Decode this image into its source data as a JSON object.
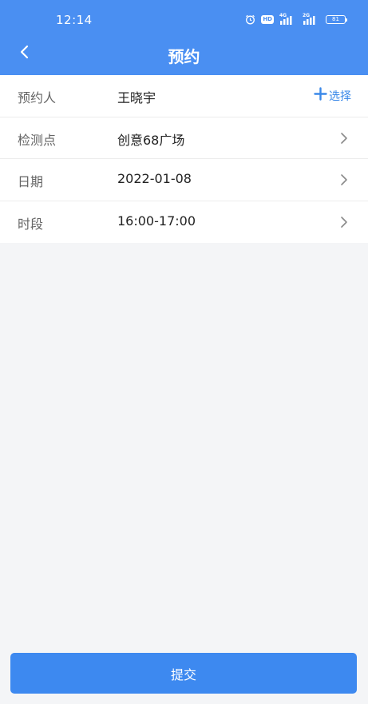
{
  "status_bar": {
    "time": "12:14",
    "hd_label": "HD",
    "network_1": "4G",
    "network_2": "2G",
    "battery": "81",
    "icons": [
      "alarm-icon",
      "hd-icon",
      "signal-4g-icon",
      "signal-2g-icon",
      "battery-icon"
    ]
  },
  "nav": {
    "title": "预约",
    "back_icon": "chevron-left-icon"
  },
  "form": {
    "rows": [
      {
        "label": "预约人",
        "value": "王晓宇",
        "action": "选择"
      },
      {
        "label": "检测点",
        "value": "创意68广场"
      },
      {
        "label": "日期",
        "value": "2022-01-08"
      },
      {
        "label": "时段",
        "value": "16:00-17:00"
      }
    ]
  },
  "submit_label": "提交",
  "colors": {
    "header": "#4a8ff2",
    "accent": "#3a88e8",
    "button": "#3d89f0",
    "background": "#f4f5f7"
  }
}
